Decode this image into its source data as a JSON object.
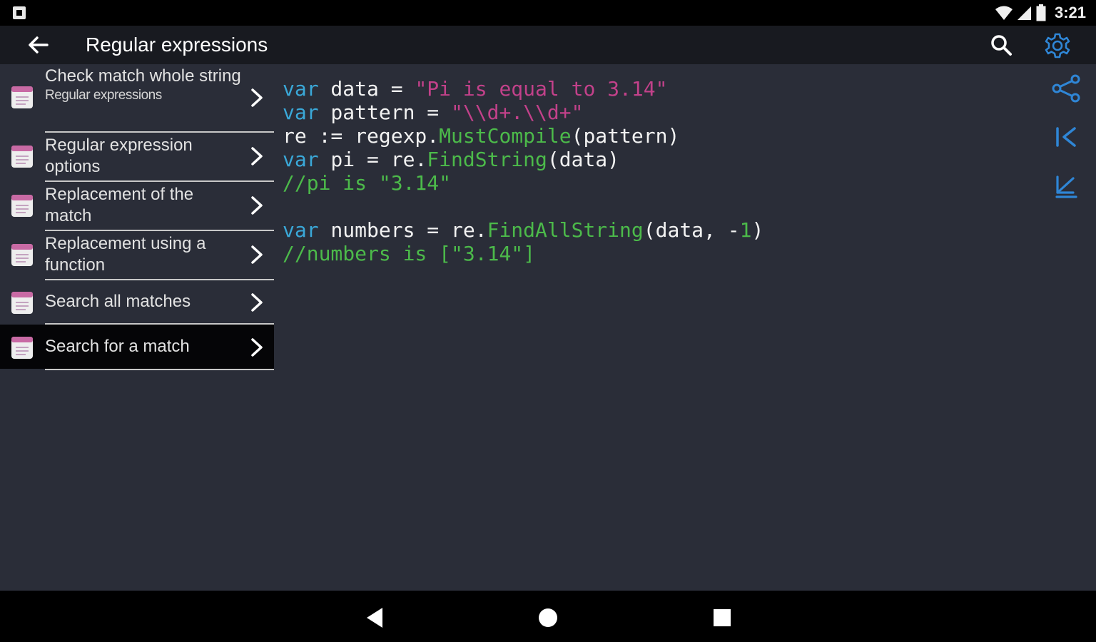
{
  "status_bar": {
    "time": "3:21"
  },
  "app_bar": {
    "title": "Regular expressions"
  },
  "sidebar": {
    "items": [
      {
        "title": "Check match whole string",
        "subtitle": "Regular expressions"
      },
      {
        "title": "Regular expression options"
      },
      {
        "title": "Replacement of the match"
      },
      {
        "title": "Replacement using a function"
      },
      {
        "title": "Search all matches"
      },
      {
        "title": "Search for a match"
      }
    ]
  },
  "code": {
    "lines": [
      [
        {
          "t": "var",
          "c": "kw"
        },
        {
          "t": " data = "
        },
        {
          "t": "\"Pi is equal to 3.14\"",
          "c": "str"
        }
      ],
      [
        {
          "t": "var",
          "c": "kw"
        },
        {
          "t": " pattern = "
        },
        {
          "t": "\"\\\\d+.\\\\d+\"",
          "c": "str"
        }
      ],
      [
        {
          "t": "re := regexp."
        },
        {
          "t": "MustCompile",
          "c": "fn"
        },
        {
          "t": "(pattern)"
        }
      ],
      [
        {
          "t": "var",
          "c": "kw"
        },
        {
          "t": " pi = re."
        },
        {
          "t": "FindString",
          "c": "fn"
        },
        {
          "t": "(data)"
        }
      ],
      [
        {
          "t": "//pi is \"3.14\"",
          "c": "cm"
        }
      ],
      [],
      [
        {
          "t": "var",
          "c": "kw"
        },
        {
          "t": " numbers = re."
        },
        {
          "t": "FindAllString",
          "c": "fn"
        },
        {
          "t": "(data, -"
        },
        {
          "t": "1",
          "c": "num"
        },
        {
          "t": ")"
        }
      ],
      [
        {
          "t": "//numbers is [\"3.14\"]",
          "c": "cm"
        }
      ]
    ]
  },
  "colors": {
    "background": "#2a2d38",
    "app_bar": "#181a20",
    "keyword": "#3aa8d8",
    "string": "#c2418a",
    "function": "#4cba4a",
    "comment": "#4cba4a",
    "accent_icons": "#2f86d6"
  },
  "icons": {
    "back": "arrow-left-icon",
    "search": "search-icon",
    "settings": "gear-icon",
    "share": "share-icon",
    "first": "skip-to-first-icon",
    "scroll_down": "arrow-down-left-icon",
    "nav_back": "triangle-back-icon",
    "nav_home": "circle-home-icon",
    "nav_recent": "square-recent-icon"
  }
}
